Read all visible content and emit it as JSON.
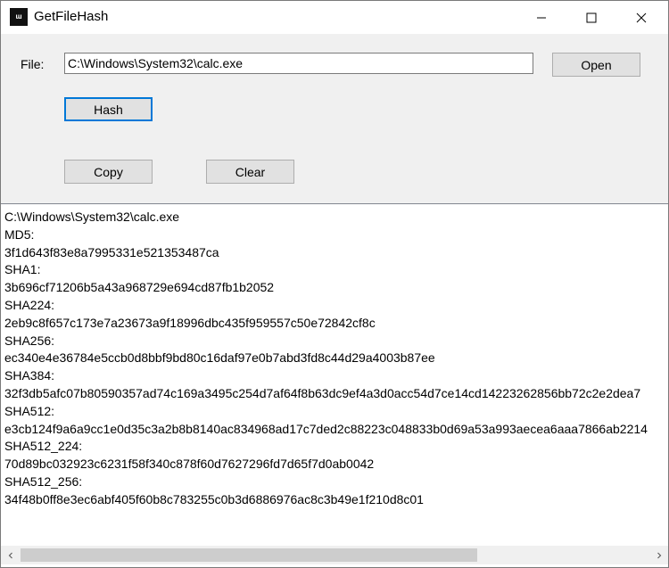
{
  "window": {
    "title": "GetFileHash",
    "icon_text": "ɯ"
  },
  "form": {
    "file_label": "File:",
    "file_value": "C:\\Windows\\System32\\calc.exe",
    "open_label": "Open",
    "hash_label": "Hash",
    "copy_label": "Copy",
    "clear_label": "Clear"
  },
  "output": {
    "lines": [
      "C:\\Windows\\System32\\calc.exe",
      "MD5:",
      "3f1d643f83e8a7995331e521353487ca",
      "SHA1:",
      "3b696cf71206b5a43a968729e694cd87fb1b2052",
      "SHA224:",
      "2eb9c8f657c173e7a23673a9f18996dbc435f959557c50e72842cf8c",
      "SHA256:",
      "ec340e4e36784e5ccb0d8bbf9bd80c16daf97e0b7abd3fd8c44d29a4003b87ee",
      "SHA384:",
      "32f3db5afc07b80590357ad74c169a3495c254d7af64f8b63dc9ef4a3d0acc54d7ce14cd14223262856bb72c2e2dea7",
      "SHA512:",
      "e3cb124f9a6a9cc1e0d35c3a2b8b8140ac834968ad17c7ded2c88223c048833b0d69a53a993aecea6aaa7866ab2214",
      "SHA512_224:",
      "70d89bc032923c6231f58f340c878f60d7627296fd7d65f7d0ab0042",
      "SHA512_256:",
      "34f48b0ff8e3ec6abf405f60b8c783255c0b3d6886976ac8c3b49e1f210d8c01"
    ]
  },
  "colors": {
    "focus_border": "#0078d7",
    "button_bg": "#e1e1e1",
    "scroll_thumb": "#cdcdcd"
  }
}
